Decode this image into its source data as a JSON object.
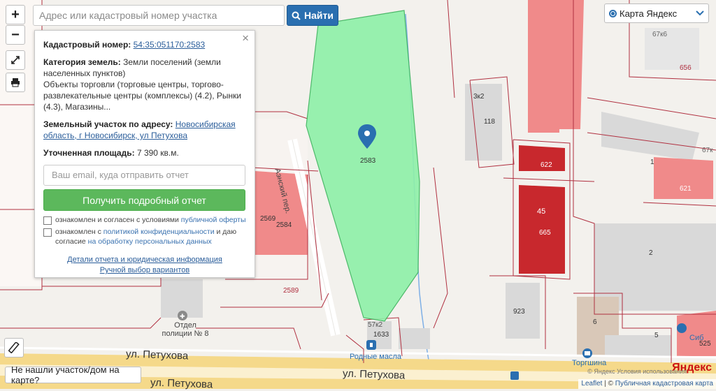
{
  "search": {
    "placeholder": "Адрес или кадастровый номер участка",
    "button_label": "Найти"
  },
  "zoom": {
    "in": "+",
    "out": "−"
  },
  "panel": {
    "close": "×",
    "cadastral_label": "Кадастровый номер:",
    "cadastral_value": "54:35:051170:2583",
    "category_label": "Категория земель:",
    "category_value": "Земли поселений (земли населенных пунктов)",
    "use_value": "Объекты торговли (торговые центры, торгово-развлекательные центры (комплексы) (4.2), Рынки (4.3), Магазины...",
    "address_label": "Земельный участок по адресу:",
    "address_value": "Новосибирская область, г Новосибирск, ул Петухова",
    "area_label": "Уточненная площадь:",
    "area_value": "7 390 кв.м.",
    "email_placeholder": "Ваш email, куда отправить отчет",
    "report_button": "Получить подробный отчет",
    "consent1_text": "ознакомлен и согласен с условиями ",
    "consent1_link": "публичной оферты",
    "consent2_text": "ознакомлен с ",
    "consent2_link": "политикой конфиденциальности",
    "consent2_text2": " и даю согласие ",
    "consent2_link2": "на обработку персональных данных",
    "link_details": "Детали отчета и юридическая информация",
    "link_manual": "Ручной выбор вариантов"
  },
  "layer_select": {
    "label": "Карта Яндекс"
  },
  "notfound": "Не нашли участок/дом на карте?",
  "attribution": {
    "leaflet": "Leaflet",
    "sep": " | © ",
    "pkk": "Публичная кадастровая карта"
  },
  "yandex": {
    "logo": "Яндекс",
    "terms": "© Яндекс   Условия использования"
  },
  "map_labels": {
    "parcel_main": "2583",
    "p2569": "2569",
    "p2584": "2584",
    "p2589": "2589",
    "p3k2": "3к2",
    "p118": "118",
    "p622": "622",
    "p45": "45",
    "p665": "665",
    "p923": "923",
    "p621": "621",
    "p656": "656",
    "p67k6": "67к6",
    "p67k": "67к",
    "p1": "1",
    "p2": "2",
    "p6": "6",
    "p5": "5",
    "p525": "525",
    "p57k2": "57к2",
    "p1633": "1633",
    "street_lane": "Аэнский пер.",
    "street_main1": "ул. Петухова",
    "street_main2": "ул. Петухова",
    "street_main3": "ул. Петухова",
    "poi_police": "Отдел полиции № 8",
    "poi_rodnye": "Родные масла",
    "poi_torgshina": "Торгшина",
    "poi_sib": "Сиб"
  },
  "colors": {
    "parcel_fill": "#8ef0a8",
    "parcel_stroke": "#3cb35c",
    "building_red": "#c8282d",
    "building_pink": "#f08a8a",
    "building_gray": "#d7d7d7",
    "cadastre_line": "#b03040",
    "road_yellow": "#f5d98a",
    "button_blue": "#2a6fb0",
    "button_green": "#5cb85c"
  },
  "icons": [
    "search-icon",
    "fullscreen-icon",
    "print-icon",
    "ruler-icon",
    "chevron-down-icon",
    "map-pin-icon",
    "police-icon",
    "fuel-icon"
  ]
}
